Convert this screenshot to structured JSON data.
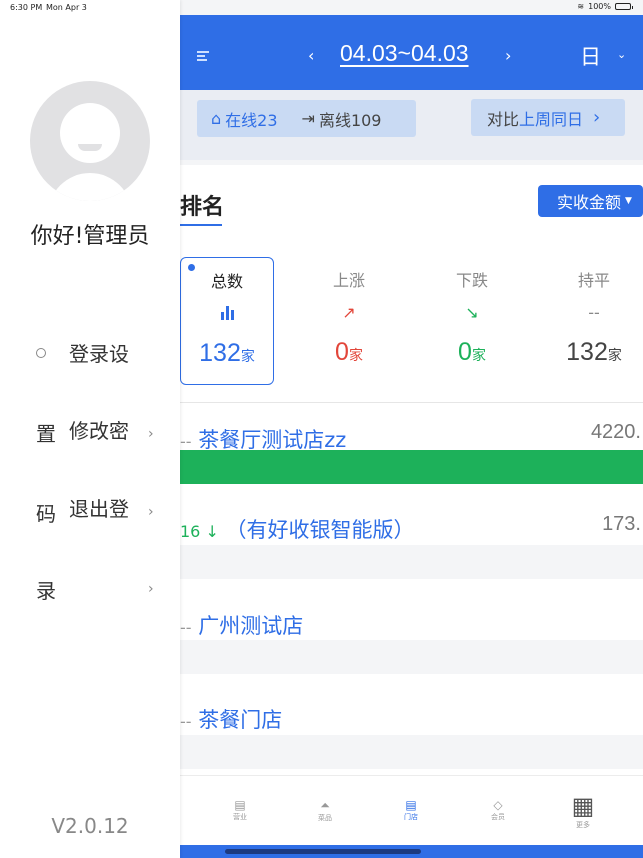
{
  "status_bar": {
    "time": "6:30 PM",
    "date": "Mon Apr 3",
    "battery": "100%",
    "battery_level": 1.0
  },
  "header": {
    "date_range": "04.03~04.03",
    "prev": "‹",
    "next": "›",
    "period": "日",
    "period_chevron": "⌄"
  },
  "online": {
    "online_label": "在线23",
    "offline_label": "离线109"
  },
  "compare": {
    "prefix": "对比",
    "highlight": "上周同日",
    "chevron": "›"
  },
  "ranking": {
    "title": "排名",
    "metric": "实收金额"
  },
  "stats": [
    {
      "label": "总数",
      "value": "132",
      "unit": "家"
    },
    {
      "label": "上涨",
      "value": "0",
      "unit": "家"
    },
    {
      "label": "下跌",
      "value": "0",
      "unit": "家"
    },
    {
      "label": "持平",
      "dash": "--",
      "value": "132",
      "unit": "家"
    }
  ],
  "stores": [
    {
      "prefix": "--",
      "name": "茶餐厅测试店zz",
      "value": "4220.",
      "bar_color": "#1db15a",
      "bar_fraction": 1.0
    },
    {
      "rank_change": "16 ↓",
      "name": "（有好收银智能版）",
      "value": "173.",
      "bar_color": "#f4f5f7"
    },
    {
      "prefix": "--",
      "name": "广州测试店",
      "value": "",
      "bar_color": "#f4f5f7"
    },
    {
      "prefix": "--",
      "name": "茶餐门店",
      "value": "",
      "bar_color": "#f4f5f7"
    }
  ],
  "tabs": [
    {
      "label": "营业",
      "icon": "store-icon"
    },
    {
      "label": "菜品",
      "icon": "dish-icon"
    },
    {
      "label": "门店",
      "icon": "shop-icon",
      "active": true
    },
    {
      "label": "会员",
      "icon": "diamond-icon"
    },
    {
      "label": "更多",
      "icon": "grid-icon"
    }
  ],
  "drawer": {
    "greeting": "你好!管理员",
    "items": [
      {
        "text": "登录设",
        "icon": "gear-icon"
      },
      {
        "left": "置",
        "text": "修改密",
        "chevron": "›"
      },
      {
        "left": "码",
        "text": "退出登",
        "chevron": "›"
      },
      {
        "left": "录",
        "chevron": "›"
      }
    ],
    "version": "V2.0.12"
  },
  "colors": {
    "primary": "#2f6ee6",
    "up": "#e2463a",
    "down": "#1db15a"
  }
}
